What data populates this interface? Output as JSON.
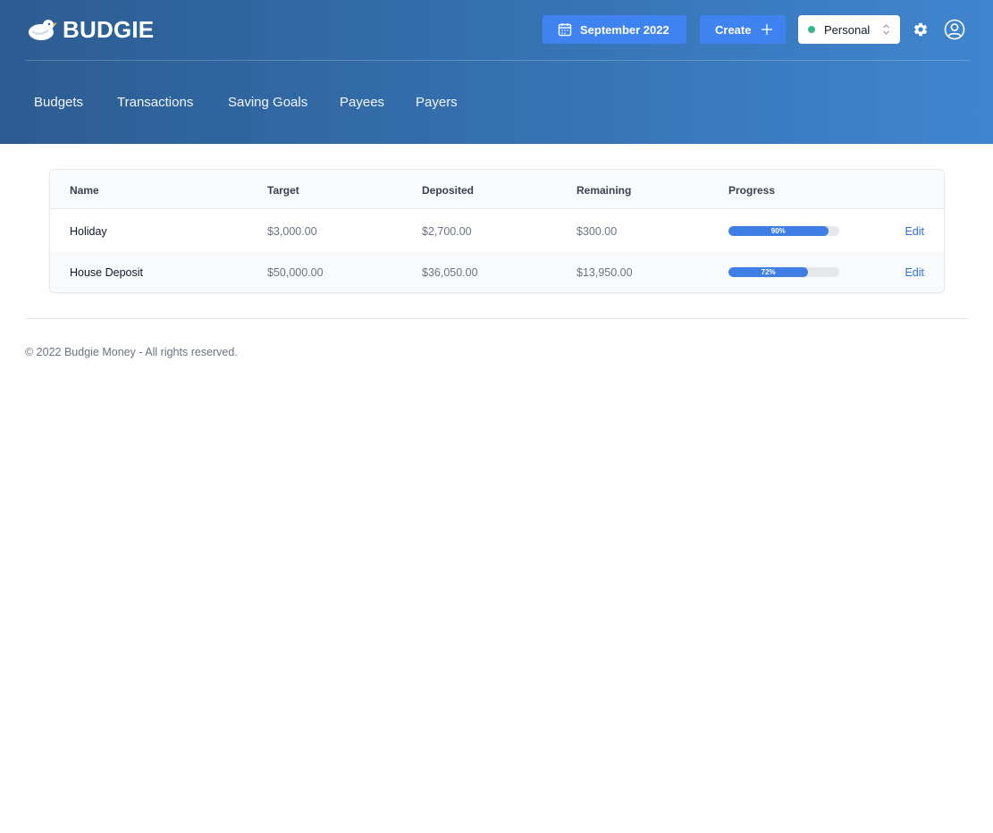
{
  "brand": {
    "name": "BUDGIE"
  },
  "header": {
    "month_label": "September 2022",
    "create_label": "Create",
    "ledger_label": "Personal"
  },
  "nav": {
    "items": [
      {
        "label": "Budgets"
      },
      {
        "label": "Transactions"
      },
      {
        "label": "Saving Goals"
      },
      {
        "label": "Payees"
      },
      {
        "label": "Payers"
      }
    ]
  },
  "table": {
    "headers": [
      "Name",
      "Target",
      "Deposited",
      "Remaining",
      "Progress"
    ],
    "rows": [
      {
        "name": "Holiday",
        "target": "$3,000.00",
        "deposited": "$2,700.00",
        "remaining": "$300.00",
        "progress": 90,
        "progress_label": "90%",
        "action": "Edit"
      },
      {
        "name": "House Deposit",
        "target": "$50,000.00",
        "deposited": "$36,050.00",
        "remaining": "$13,950.00",
        "progress": 72,
        "progress_label": "72%",
        "action": "Edit"
      }
    ]
  },
  "footer": {
    "text": "© 2022 Budgie Money - All rights reserved."
  },
  "colors": {
    "header_start": "#2c5c91",
    "header_end": "#3f86cf",
    "accent": "#3f83f0",
    "progress": "#3f7ee3",
    "ledger_status": "#34b78f",
    "link": "#2f6fd6"
  },
  "icons": {
    "logo": "bird-logo-icon",
    "month": "calendar-icon",
    "create": "plus-icon",
    "ledger": "chevron-updown-icon",
    "settings": "gear-icon",
    "account": "user-circle-icon"
  }
}
